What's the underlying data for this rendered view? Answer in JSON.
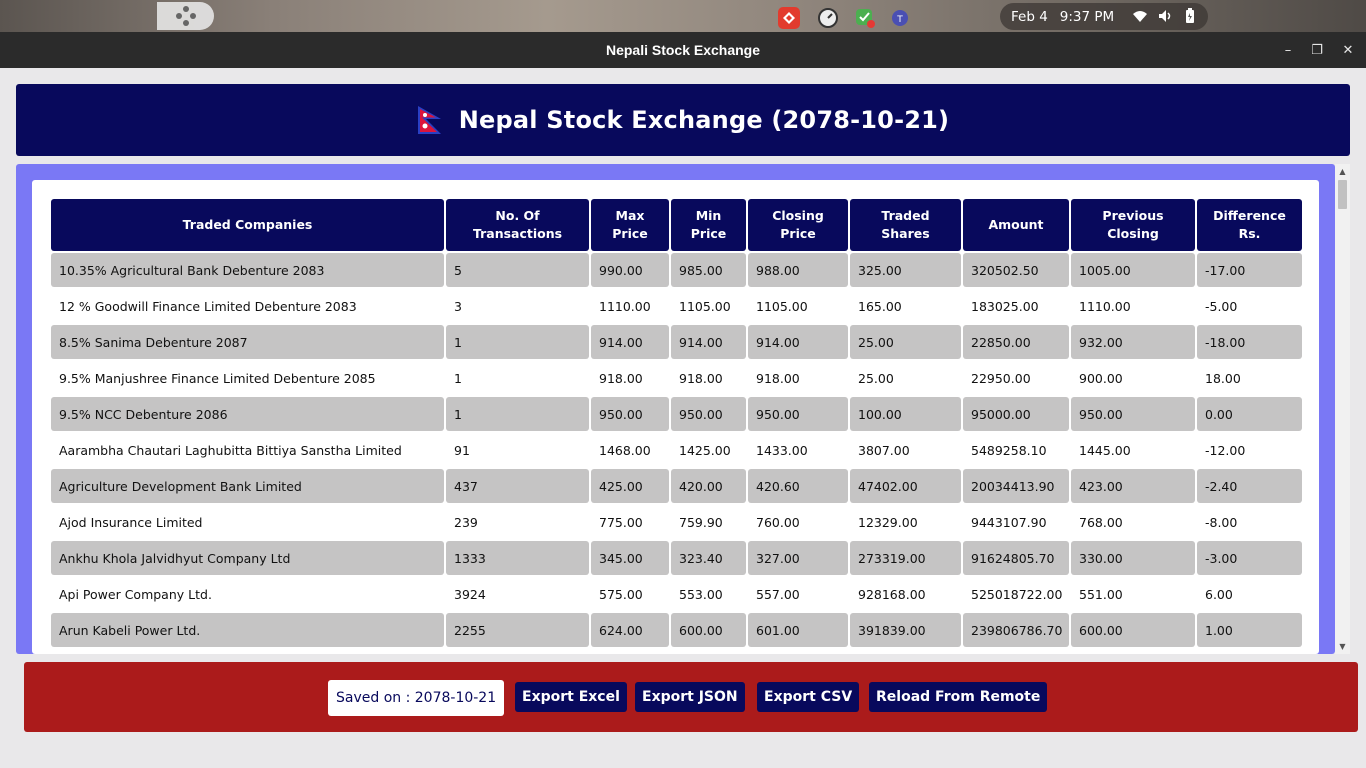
{
  "system": {
    "date": "Feb 4",
    "time": "9:37 PM"
  },
  "window": {
    "title": "Nepali Stock Exchange",
    "minimize": "–",
    "maximize": "❐",
    "close": "✕"
  },
  "header": {
    "title": "Nepal Stock Exchange (2078-10-21)"
  },
  "table": {
    "columns": [
      "Traded Companies",
      "No. Of Transactions",
      "Max Price",
      "Min Price",
      "Closing Price",
      "Traded Shares",
      "Amount",
      "Previous Closing",
      "Difference Rs."
    ],
    "rows": [
      [
        "10.35% Agricultural Bank Debenture 2083",
        "5",
        "990.00",
        "985.00",
        "988.00",
        "325.00",
        "320502.50",
        "1005.00",
        "-17.00"
      ],
      [
        "12 % Goodwill Finance Limited Debenture 2083",
        "3",
        "1110.00",
        "1105.00",
        "1105.00",
        "165.00",
        "183025.00",
        "1110.00",
        "-5.00"
      ],
      [
        "8.5% Sanima Debenture 2087",
        "1",
        "914.00",
        "914.00",
        "914.00",
        "25.00",
        "22850.00",
        "932.00",
        "-18.00"
      ],
      [
        "9.5% Manjushree Finance Limited Debenture 2085",
        "1",
        "918.00",
        "918.00",
        "918.00",
        "25.00",
        "22950.00",
        "900.00",
        "18.00"
      ],
      [
        "9.5% NCC Debenture 2086",
        "1",
        "950.00",
        "950.00",
        "950.00",
        "100.00",
        "95000.00",
        "950.00",
        "0.00"
      ],
      [
        "Aarambha Chautari Laghubitta Bittiya Sanstha Limited",
        "91",
        "1468.00",
        "1425.00",
        "1433.00",
        "3807.00",
        "5489258.10",
        "1445.00",
        "-12.00"
      ],
      [
        "Agriculture Development Bank Limited",
        "437",
        "425.00",
        "420.00",
        "420.60",
        "47402.00",
        "20034413.90",
        "423.00",
        "-2.40"
      ],
      [
        "Ajod Insurance Limited",
        "239",
        "775.00",
        "759.90",
        "760.00",
        "12329.00",
        "9443107.90",
        "768.00",
        "-8.00"
      ],
      [
        "Ankhu Khola Jalvidhyut Company Ltd",
        "1333",
        "345.00",
        "323.40",
        "327.00",
        "273319.00",
        "91624805.70",
        "330.00",
        "-3.00"
      ],
      [
        "Api Power Company Ltd.",
        "3924",
        "575.00",
        "553.00",
        "557.00",
        "928168.00",
        "525018722.00",
        "551.00",
        "6.00"
      ],
      [
        "Arun Kabeli Power Ltd.",
        "2255",
        "624.00",
        "600.00",
        "601.00",
        "391839.00",
        "239806786.70",
        "600.00",
        "1.00"
      ]
    ]
  },
  "footer": {
    "saved_label": "Saved on : 2078-10-21",
    "export_excel": "Export Excel",
    "export_json": "Export JSON",
    "export_csv": "Export CSV",
    "reload": "Reload From Remote"
  },
  "colors": {
    "navy": "#08095c",
    "accent_purple": "#7a78f5",
    "footer_red": "#ab1b1b",
    "row_gray": "#c5c4c4"
  }
}
